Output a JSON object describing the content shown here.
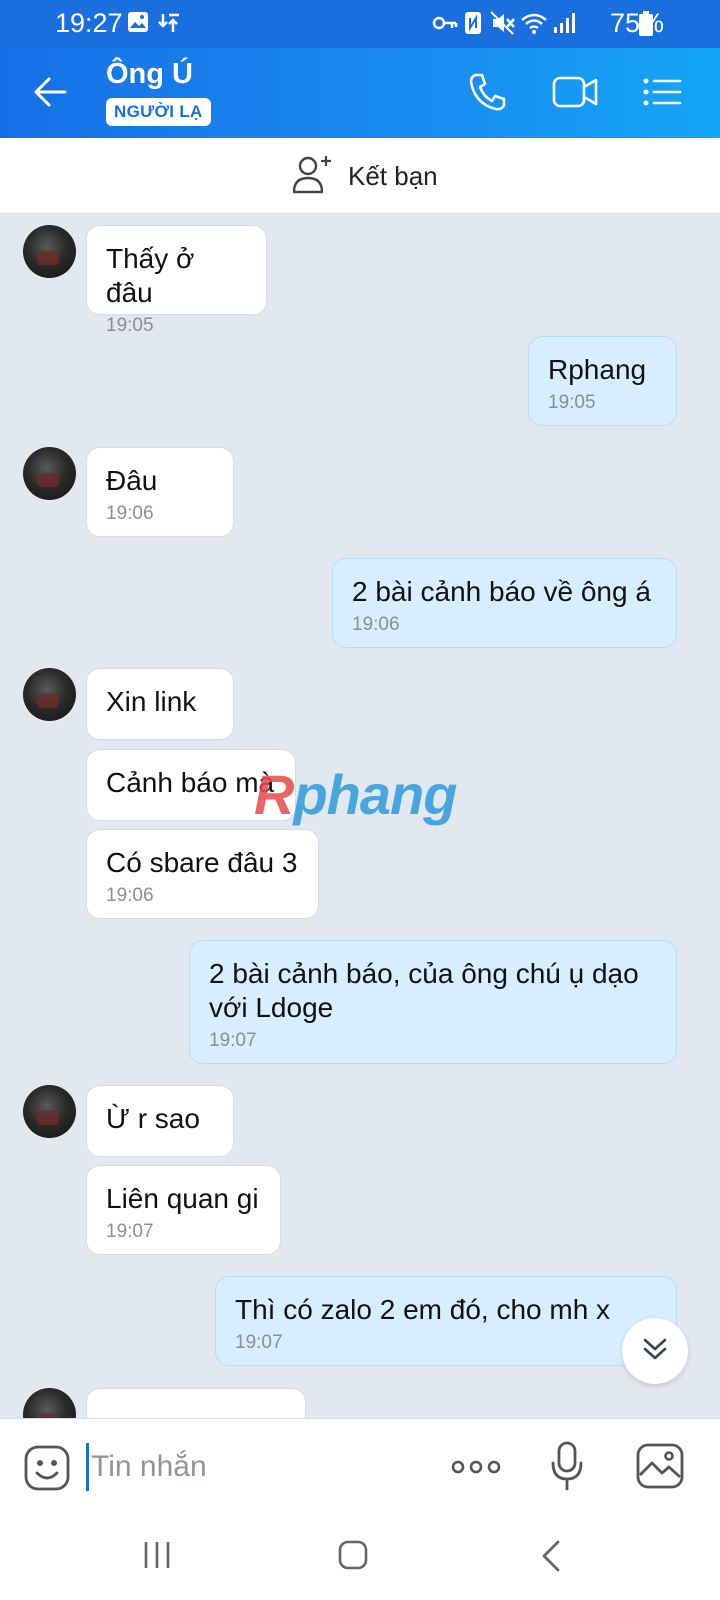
{
  "status_bar": {
    "time": "19:27",
    "battery": "75%",
    "icons": [
      "gallery-icon",
      "download-icon",
      "key-icon",
      "nfc-icon",
      "mute-icon",
      "wifi-icon",
      "signal-icon",
      "battery-icon"
    ]
  },
  "header": {
    "contact_name": "Ông Ú",
    "badge": "NGƯỜI LẠ",
    "colors": {
      "start": "#1570e6",
      "end": "#13a6f5"
    }
  },
  "add_friend": {
    "label": "Kết bạn"
  },
  "messages": [
    {
      "side": "in",
      "text": "Thấy ở đâu",
      "time": "19:05"
    },
    {
      "side": "out",
      "text": "Rphang",
      "time": "19:05"
    },
    {
      "side": "in",
      "text": "Đâu",
      "time": "19:06"
    },
    {
      "side": "out",
      "text": "2 bài cảnh báo về ông á",
      "time": "19:06"
    },
    {
      "side": "in",
      "text": "Xin link",
      "time": ""
    },
    {
      "side": "in",
      "text": "Cảnh báo mà",
      "time": ""
    },
    {
      "side": "in",
      "text": "Có sbare đâu 3",
      "time": "19:06"
    },
    {
      "side": "out",
      "text": "2 bài cảnh báo, của ông chú ụ dạo với Ldoge",
      "time": "19:07"
    },
    {
      "side": "in",
      "text": "Ừ r sao",
      "time": ""
    },
    {
      "side": "in",
      "text": "Liên quan gi",
      "time": "19:07"
    },
    {
      "side": "out",
      "text": "Thì có zalo 2 em đó, cho mh x",
      "time": "19:07"
    }
  ],
  "watermark": {
    "first": "R",
    "rest": "phang"
  },
  "input": {
    "placeholder": "Tin nhắn",
    "value": ""
  },
  "colors": {
    "accent": "#1a6fde",
    "chat_bg": "#e2e8ef",
    "outgoing": "#d6eeff",
    "incoming": "#ffffff"
  }
}
